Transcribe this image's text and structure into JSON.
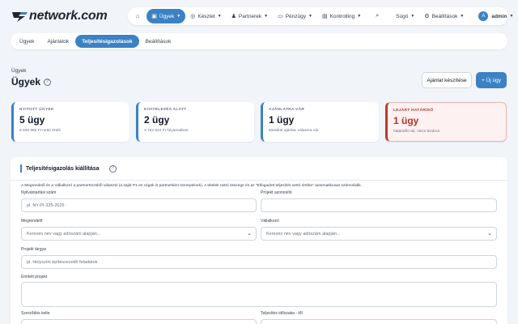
{
  "brand": {
    "logo_text": "network.com"
  },
  "nav": {
    "home_icon": "home-icon",
    "items": [
      {
        "label": "Ügyek",
        "icon": "briefcase-icon",
        "active": true
      },
      {
        "label": "Készlet",
        "icon": "box-icon"
      },
      {
        "label": "Partnerek",
        "icon": "users-icon"
      },
      {
        "label": "Pénzügy",
        "icon": "wallet-icon"
      },
      {
        "label": "Kontrolling",
        "icon": "chart-icon"
      }
    ],
    "search_icon": "search-icon",
    "help_label": "Súgó",
    "settings_label": "Beállítások",
    "user_initial": "A",
    "user_name": "admin"
  },
  "subtabs": [
    "Ügyek",
    "Ajánlatok",
    "Teljesítésigazolások",
    "Beállítások"
  ],
  "breadcrumb": "Ügyek",
  "page_title": "Ügyek",
  "actions": {
    "quote": "Ajánlat készítése",
    "new_case": "+ Új ügy"
  },
  "cards": [
    {
      "label": "NYITOTT ÜGYEK",
      "value": "5 ügy",
      "sub": "9 406 960 Ft nettó érték"
    },
    {
      "label": "KIVITELEZÉS ALATT",
      "value": "2 ügy",
      "sub": "3 762 624 Ft folyamatban"
    },
    {
      "label": "AJÁNLATRA VÁR",
      "value": "1 ügy",
      "sub": "kiküldött ajánlat, válaszra vár"
    },
    {
      "label": "LEJÁRT HATÁRIDŐ",
      "value": "1 ügy",
      "sub": "határidőn túl, nincs lezárva"
    }
  ],
  "form": {
    "title": "Teljesítésigazolás kiállítása",
    "info": "A Megrendelő és a Vállalkozó a partnertörzsből választó (a saját P1-es cégek is partnerként szerepelnek). A tételek nettó összege és az \"Elfogadott teljesítés nettó értéke\" automatikusan számolódik.",
    "fields": {
      "record_no_label": "Nyilvántartási szám",
      "record_no_placeholder": "pl. NY-PI-335-2025",
      "project_id_label": "Projekt azonosító",
      "project_id_value": "",
      "customer_label": "Megrendelő",
      "customer_placeholder": "Keresés név vagy adószám alapján...",
      "contractor_label": "Vállalkozó",
      "contractor_placeholder": "Keresés név vagy adószám alapján...",
      "subject_label": "Projekt tárgya",
      "subject_placeholder": "pl. Helyszíni építésvezetői feladatok",
      "affected_label": "Érintett projekt",
      "contract_date_label": "Szerződés kelte",
      "period_label": "Teljesítés időszaka - től"
    }
  },
  "colors": {
    "accent": "#3b82c4",
    "danger": "#b0342a"
  }
}
